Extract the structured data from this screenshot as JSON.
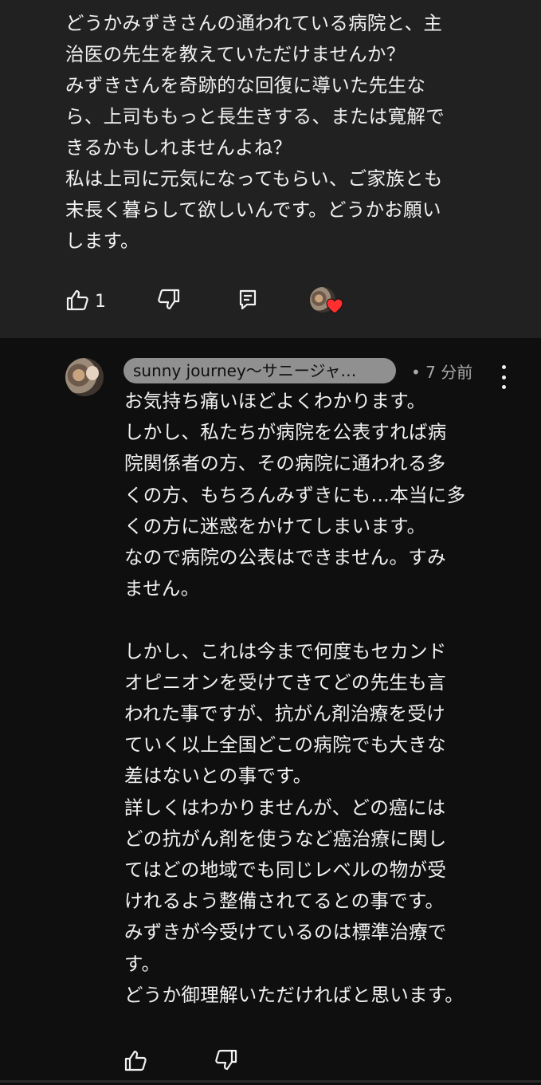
{
  "parent_comment": {
    "text": "どうかみずきさんの通われている病院と、主\n治医の先生を教えていただけませんか？\nみずきさんを奇跡的な回復に導いた先生な\nら、上司ももっと長生きする、または寛解で\nきるかもしれませんよね？\n私は上司に元気になってもらい、ご家族とも\n末長く暮らして欲しいんです。どうかお願い\nします。",
    "like_count": "1",
    "icons": [
      "like-icon",
      "dislike-icon",
      "reply-icon",
      "creator-heart-icon"
    ]
  },
  "reply_comment": {
    "author": "sunny journey～サニージャ…",
    "timestamp": "• 7 分前",
    "text": "お気持ち痛いほどよくわかります。\nしかし、私たちが病院を公表すれば病\n院関係者の方、その病院に通われる多\nくの方、もちろんみずきにも…本当に多\nくの方に迷惑をかけてしまいます。\nなので病院の公表はできません。すみ\nません。\n\nしかし、これは今まで何度もセカンド\nオピニオンを受けてきてどの先生も言\nわれた事ですが、抗がん剤治療を受け\nていく以上全国どこの病院でも大きな\n差はないとの事です。\n詳しくはわかりませんが、どの癌には\nどの抗がん剤を使うなど癌治療に関し\nてはどの地域でも同じレベルの物が受\nけれるよう整備されてるとの事です。\nみずきが今受けているのは標準治療で\nす。\nどうか御理解いただければと思います。",
    "icons": [
      "like-icon",
      "dislike-icon",
      "more-vert-icon"
    ]
  },
  "colors": {
    "parent_bg": "#212121",
    "page_bg": "#0f0f0f",
    "text": "#f1f1f1",
    "author_chip": "#909090",
    "heart": "#ff2f2f"
  }
}
